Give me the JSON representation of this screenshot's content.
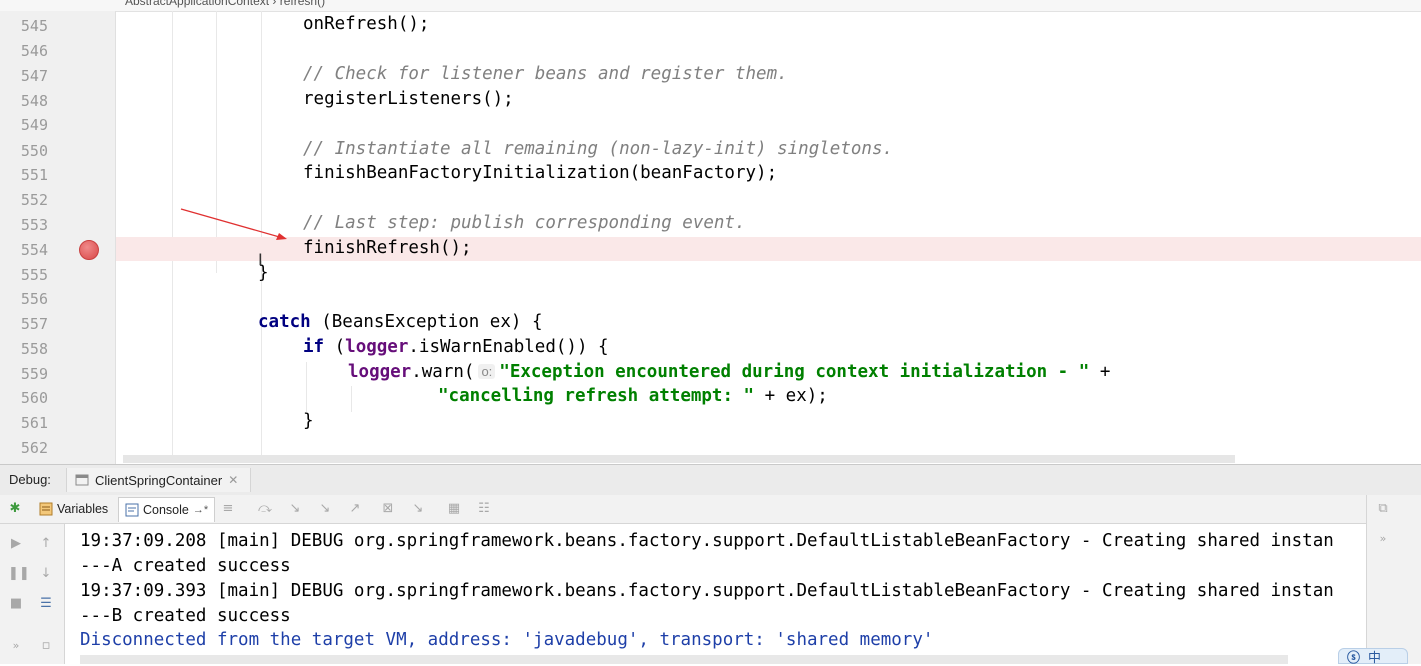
{
  "window": {
    "breadcrumb": "AbstractApplicationContext  ›  refresh()"
  },
  "editor": {
    "lines": [
      {
        "n": "545",
        "html": "<span class=\"indent\">            </span>onRefresh();"
      },
      {
        "n": "546"
      },
      {
        "n": "547"
      },
      {
        "n": "548"
      },
      {
        "n": "549"
      },
      {
        "n": "550"
      },
      {
        "n": "551"
      },
      {
        "n": "552"
      },
      {
        "n": "553"
      },
      {
        "n": "554"
      },
      {
        "n": "555"
      },
      {
        "n": "556"
      },
      {
        "n": "557"
      },
      {
        "n": "558"
      },
      {
        "n": "559"
      },
      {
        "n": "560"
      },
      {
        "n": "561"
      },
      {
        "n": "562"
      }
    ],
    "code": {
      "l545": "onRefresh();",
      "l547": "// Check for listener beans and register them.",
      "l548": "registerListeners();",
      "l550": "// Instantiate all remaining (non-lazy-init) singletons.",
      "l551": "finishBeanFactoryInitialization(beanFactory);",
      "l553": "// Last step: publish corresponding event.",
      "l554": "finishRefresh();",
      "l555": "}",
      "l557_kw": "catch",
      "l557_rest": " (BeansException ex) {",
      "l558_kw": "if",
      "l558_open": " (",
      "l558_fld": "logger",
      "l558_rest": ".isWarnEnabled()) {",
      "l559_fld": "logger",
      "l559_call": ".warn(",
      "l559_hint": "o:",
      "l559_str": "\"Exception encountered during context initialization - \"",
      "l559_tail": " +",
      "l560_str": "\"cancelling refresh attempt: \"",
      "l560_tail": " + ex);",
      "l561": "}"
    },
    "breakpoint_line": "554",
    "colors": {
      "comment": "#808080",
      "keyword": "#000080",
      "string": "#008000",
      "field": "#660e7a",
      "highlight": "#fae8e8",
      "arrow": "#e03030"
    }
  },
  "debug": {
    "label": "Debug:",
    "session_tab": "ClientSpringContainer",
    "tabs": {
      "variables": "Variables",
      "console": "Console"
    },
    "console_lines": [
      "19:37:09.208 [main] DEBUG org.springframework.beans.factory.support.DefaultListableBeanFactory - Creating shared instan",
      "---A created success",
      "19:37:09.393 [main] DEBUG org.springframework.beans.factory.support.DefaultListableBeanFactory - Creating shared instan",
      "---B created success",
      "Disconnected from the target VM, address: 'javadebug', transport: 'shared memory'"
    ]
  },
  "ime": {
    "label": "中"
  }
}
